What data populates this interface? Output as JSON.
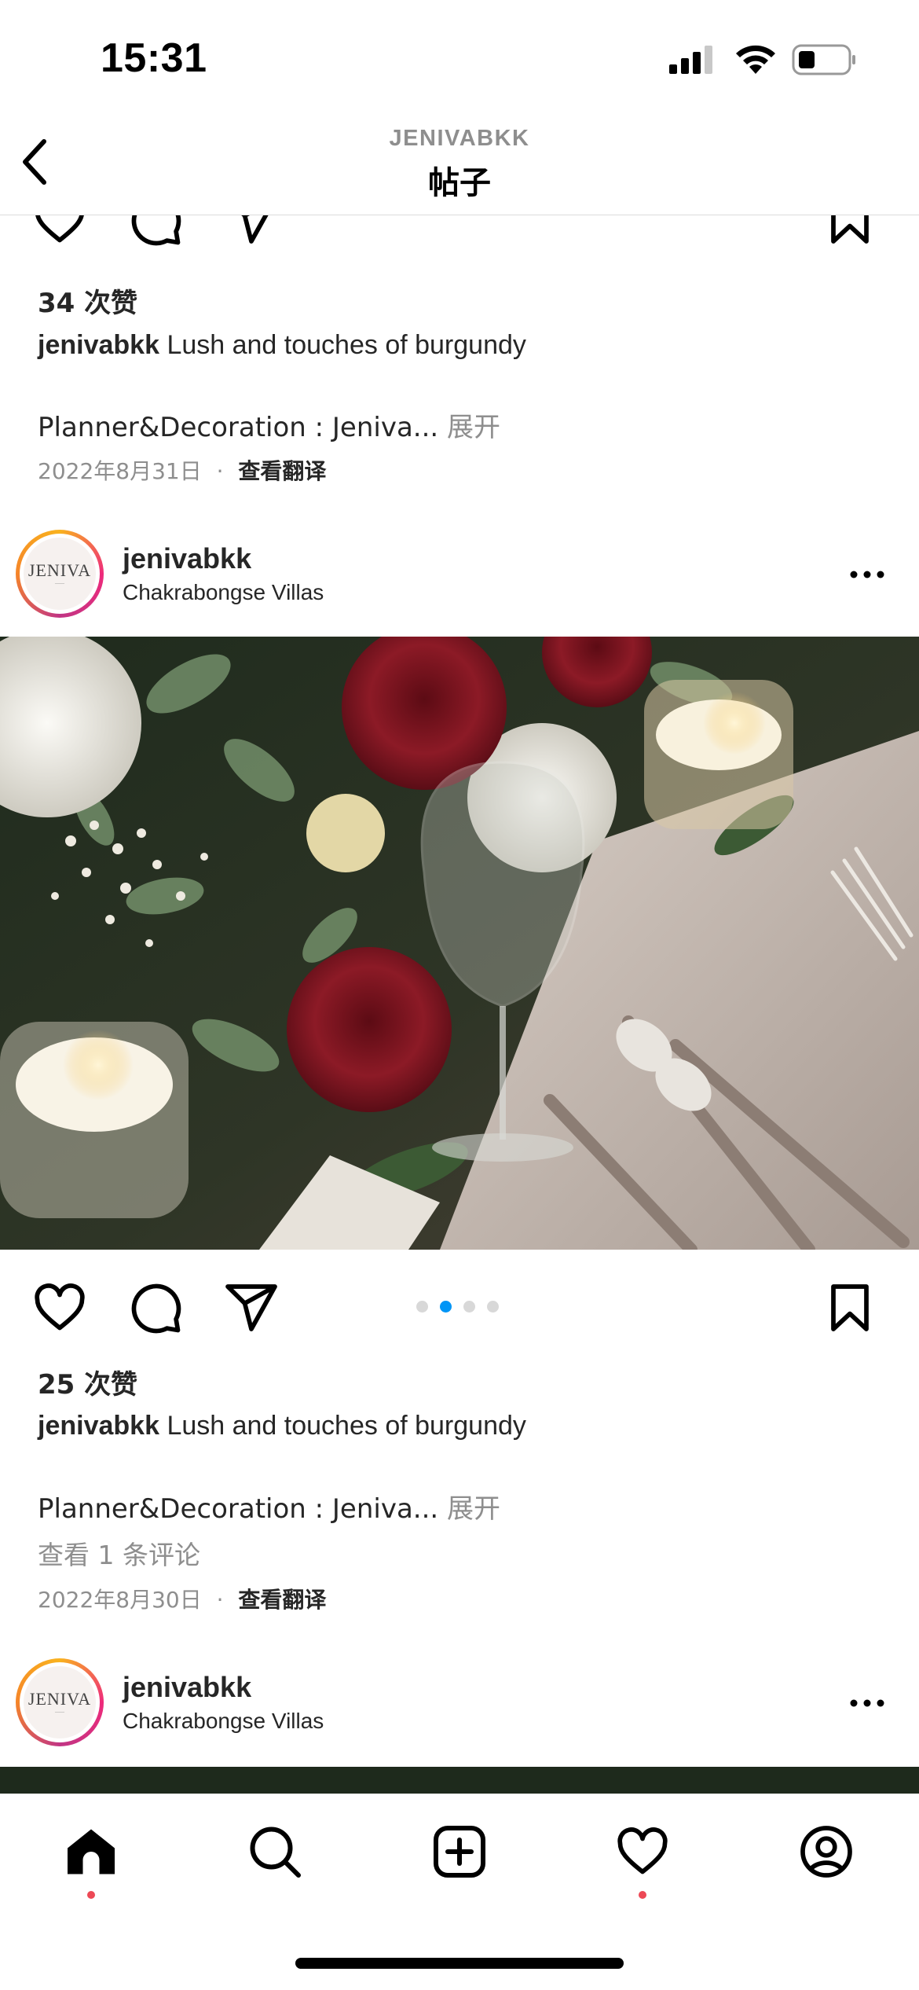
{
  "status_bar": {
    "time": "15:31"
  },
  "header": {
    "username": "JENIVABKK",
    "title": "帖子"
  },
  "posts": [
    {
      "likes": "34 次赞",
      "caption_user": "jenivabkk",
      "caption_text": "Lush and touches of burgundy",
      "caption_more": "Planner&Decoration : Jeniva...",
      "expand": "展开",
      "date": "2022年8月31日",
      "separator": "·",
      "translate": "查看翻译"
    },
    {
      "username": "jenivabkk",
      "location": "Chakrabongse Villas",
      "avatar_text": "JENIVA",
      "carousel_count": 4,
      "carousel_active": 2,
      "likes": "25 次赞",
      "caption_user": "jenivabkk",
      "caption_text": "Lush and touches of burgundy",
      "caption_more": "Planner&Decoration : Jeniva...",
      "expand": "展开",
      "comments": "查看 1 条评论",
      "date": "2022年8月30日",
      "separator": "·",
      "translate": "查看翻译"
    },
    {
      "username": "jenivabkk",
      "location": "Chakrabongse Villas",
      "avatar_text": "JENIVA"
    }
  ],
  "tab_bar": {
    "items": [
      "home-icon",
      "search-icon",
      "create-icon",
      "activity-icon",
      "profile-icon"
    ]
  },
  "colors": {
    "accent": "#0095f6",
    "notification": "#ed4956",
    "text": "#262626",
    "secondary": "#8e8e8e"
  }
}
